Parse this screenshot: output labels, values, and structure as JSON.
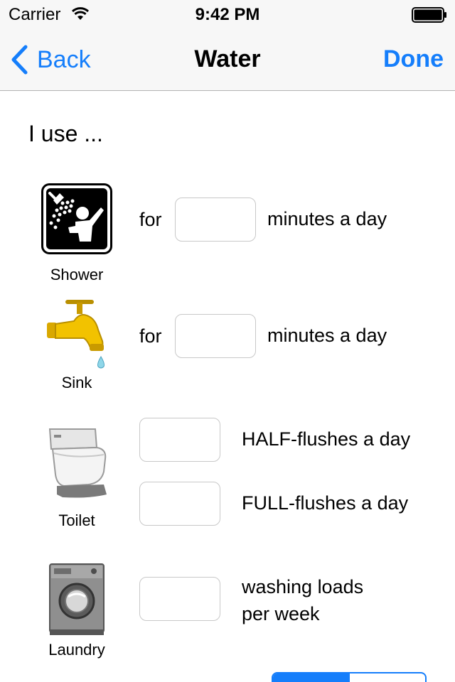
{
  "status_bar": {
    "carrier": "Carrier",
    "time": "9:42 PM"
  },
  "nav": {
    "back_label": "Back",
    "title": "Water",
    "done_label": "Done",
    "accent_color": "#157efb"
  },
  "intro_text": "I use ...",
  "items": {
    "shower": {
      "label": "Shower",
      "prefix": "for",
      "suffix": "minutes a day",
      "value": ""
    },
    "sink": {
      "label": "Sink",
      "prefix": "for",
      "suffix": "minutes a day",
      "value": ""
    },
    "toilet": {
      "label": "Toilet",
      "half_suffix": "HALF-flushes a day",
      "half_value": "",
      "full_suffix": "FULL-flushes a day",
      "full_value": ""
    },
    "laundry": {
      "label": "Laundry",
      "suffix_line1": "washing loads",
      "suffix_line2": "per week",
      "value": ""
    }
  },
  "icons": [
    "wifi-icon",
    "battery-icon",
    "chevron-left-icon",
    "shower-icon",
    "faucet-icon",
    "toilet-icon",
    "washing-machine-icon"
  ]
}
